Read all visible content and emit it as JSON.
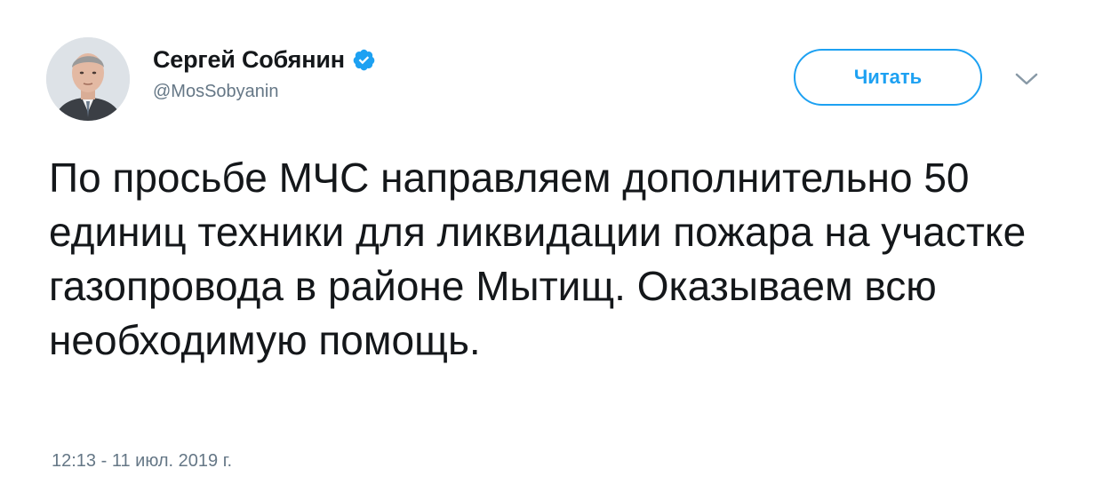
{
  "author": {
    "display_name": "Сергей Собянин",
    "handle": "@MosSobyanin",
    "verified": true
  },
  "follow_button": {
    "label": "Читать"
  },
  "icons": {
    "avatar": "profile-photo",
    "verified": "verified-badge-icon",
    "menu": "chevron-down-icon"
  },
  "tweet": {
    "text": "По просьбе МЧС направляем дополнительно 50 единиц техники для ликвидации пожара на участке газопровода в районе Мытищ. Оказываем всю необходимую помощь.",
    "timestamp": "12:13 - 11 июл. 2019 г."
  },
  "colors": {
    "accent": "#1da1f2",
    "text": "#14171a",
    "secondary": "#657786"
  }
}
